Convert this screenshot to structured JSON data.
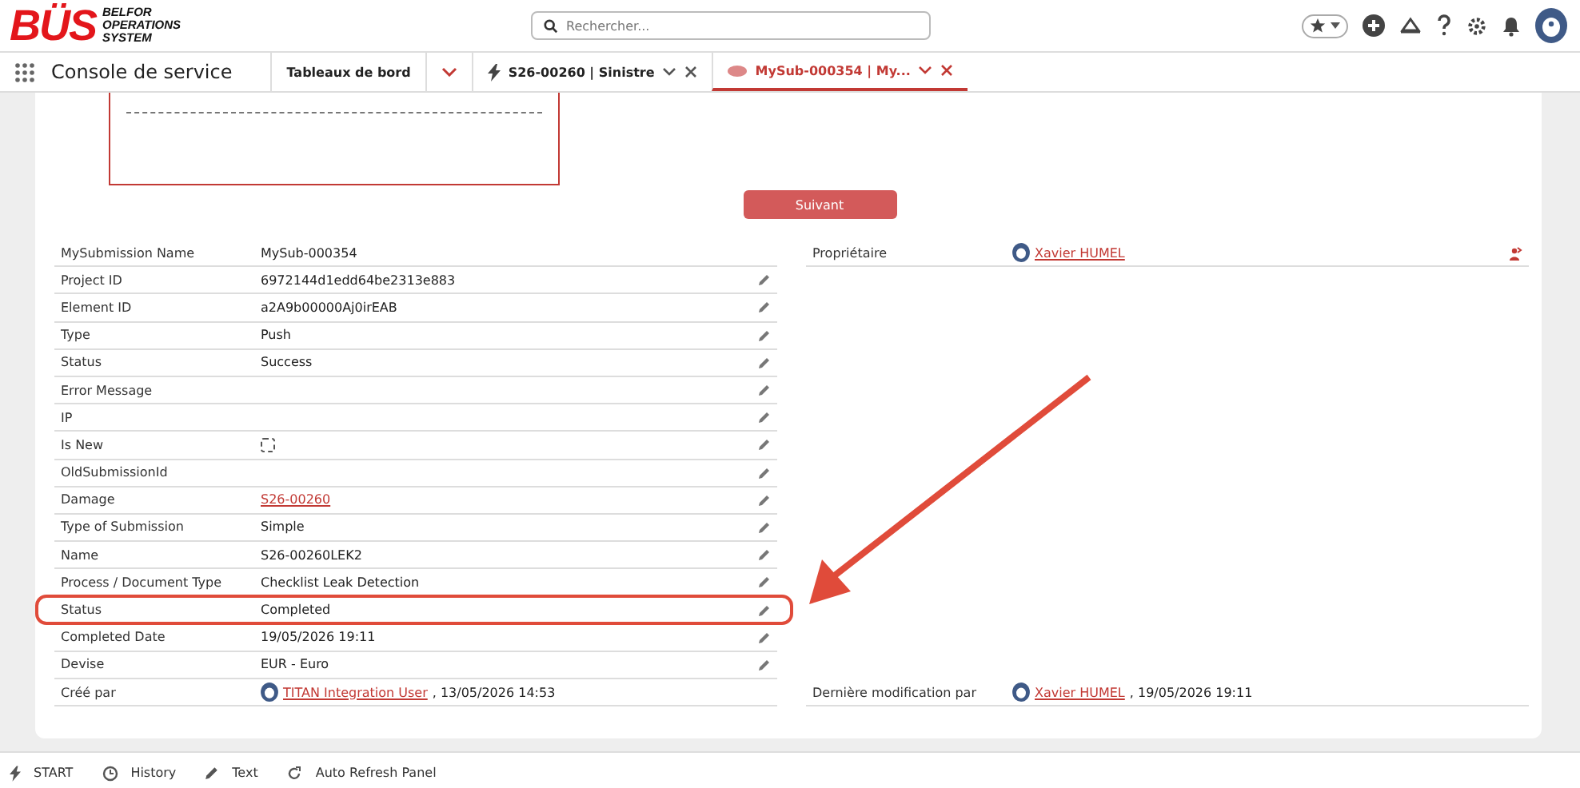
{
  "header": {
    "logo_letters": "BÜS",
    "logo_text": [
      "BELFOR",
      "OPERATIONS",
      "SYSTEM"
    ],
    "search": {
      "placeholder": "Rechercher..."
    }
  },
  "nav": {
    "app_name": "Console de service",
    "tabs": [
      {
        "label": "Tableaux de bord",
        "kind": "menu",
        "selected": false
      },
      {
        "label": "S26-00260 | Sinistre",
        "kind": "record",
        "selected": false
      },
      {
        "label": "MySub-000354 | My...",
        "kind": "submission",
        "selected": true
      }
    ]
  },
  "form": {
    "next_button": "Suivant",
    "left_fields": [
      {
        "label": "MySubmission Name",
        "value": "MySub-000354",
        "kind": "text",
        "editable": false
      },
      {
        "label": "Project ID",
        "value": "6972144d1edd64be2313e883",
        "kind": "text",
        "editable": true
      },
      {
        "label": "Element ID",
        "value": "a2A9b00000Aj0irEAB",
        "kind": "text",
        "editable": true
      },
      {
        "label": "Type",
        "value": "Push",
        "kind": "text",
        "editable": true
      },
      {
        "label": "Status",
        "value": "Success",
        "kind": "text",
        "editable": true
      },
      {
        "label": "Error Message",
        "kind": "text",
        "editable": true
      },
      {
        "label": "IP",
        "kind": "text",
        "editable": true
      },
      {
        "label": "Is New",
        "kind": "checkbox",
        "checked": false,
        "editable": true
      },
      {
        "label": "OldSubmissionId",
        "kind": "text",
        "editable": true
      },
      {
        "label": "Damage",
        "value": "S26-00260",
        "kind": "link",
        "editable": true
      },
      {
        "label": "Type of Submission",
        "value": "Simple",
        "kind": "text",
        "editable": true
      },
      {
        "label": "Name",
        "value": "S26-00260LEK2",
        "kind": "text",
        "editable": true
      },
      {
        "label": "Process / Document Type",
        "value": "Checklist Leak Detection",
        "kind": "text",
        "editable": true
      },
      {
        "label": "Status",
        "value": "Completed",
        "kind": "text",
        "editable": true,
        "highlighted": true
      },
      {
        "label": "Completed Date",
        "value": "19/05/2026 19:11",
        "kind": "text",
        "editable": true
      },
      {
        "label": "Devise",
        "value": "EUR - Euro",
        "kind": "text",
        "editable": true
      },
      {
        "label": "Créé par",
        "value": "TITAN Integration User",
        "date": ", 13/05/2026 14:53",
        "kind": "user",
        "editable": false
      }
    ],
    "right_fields": [
      {
        "label": "Propriétaire",
        "value": "Xavier HUMEL",
        "kind": "owner"
      },
      {
        "label": "Dernière modification par",
        "value": "Xavier HUMEL",
        "date": ", 19/05/2026 19:11",
        "kind": "user"
      }
    ]
  },
  "footer": [
    {
      "label": "START",
      "kind": "bolt"
    },
    {
      "label": "History",
      "kind": "clock"
    },
    {
      "label": "Text",
      "kind": "pencil"
    },
    {
      "label": "Auto Refresh Panel",
      "kind": "refresh"
    }
  ]
}
